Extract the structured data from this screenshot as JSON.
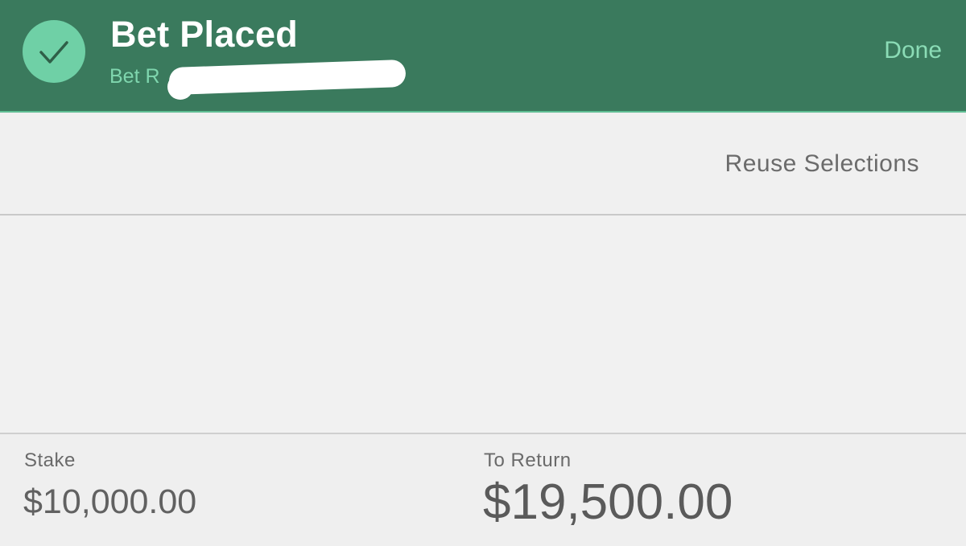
{
  "header": {
    "title": "Bet Placed",
    "subtitle": "Bet R",
    "done_label": "Done",
    "icon": "checkmark-icon",
    "colors": {
      "background": "#3a7a5d",
      "accent": "#6fd0a6",
      "title": "#ffffff",
      "done": "#8bdcb6"
    }
  },
  "actions": {
    "reuse_label": "Reuse Selections"
  },
  "summary": {
    "stake_label": "Stake",
    "stake_value": "$10,000.00",
    "return_label": "To Return",
    "return_value": "$19,500.00"
  }
}
